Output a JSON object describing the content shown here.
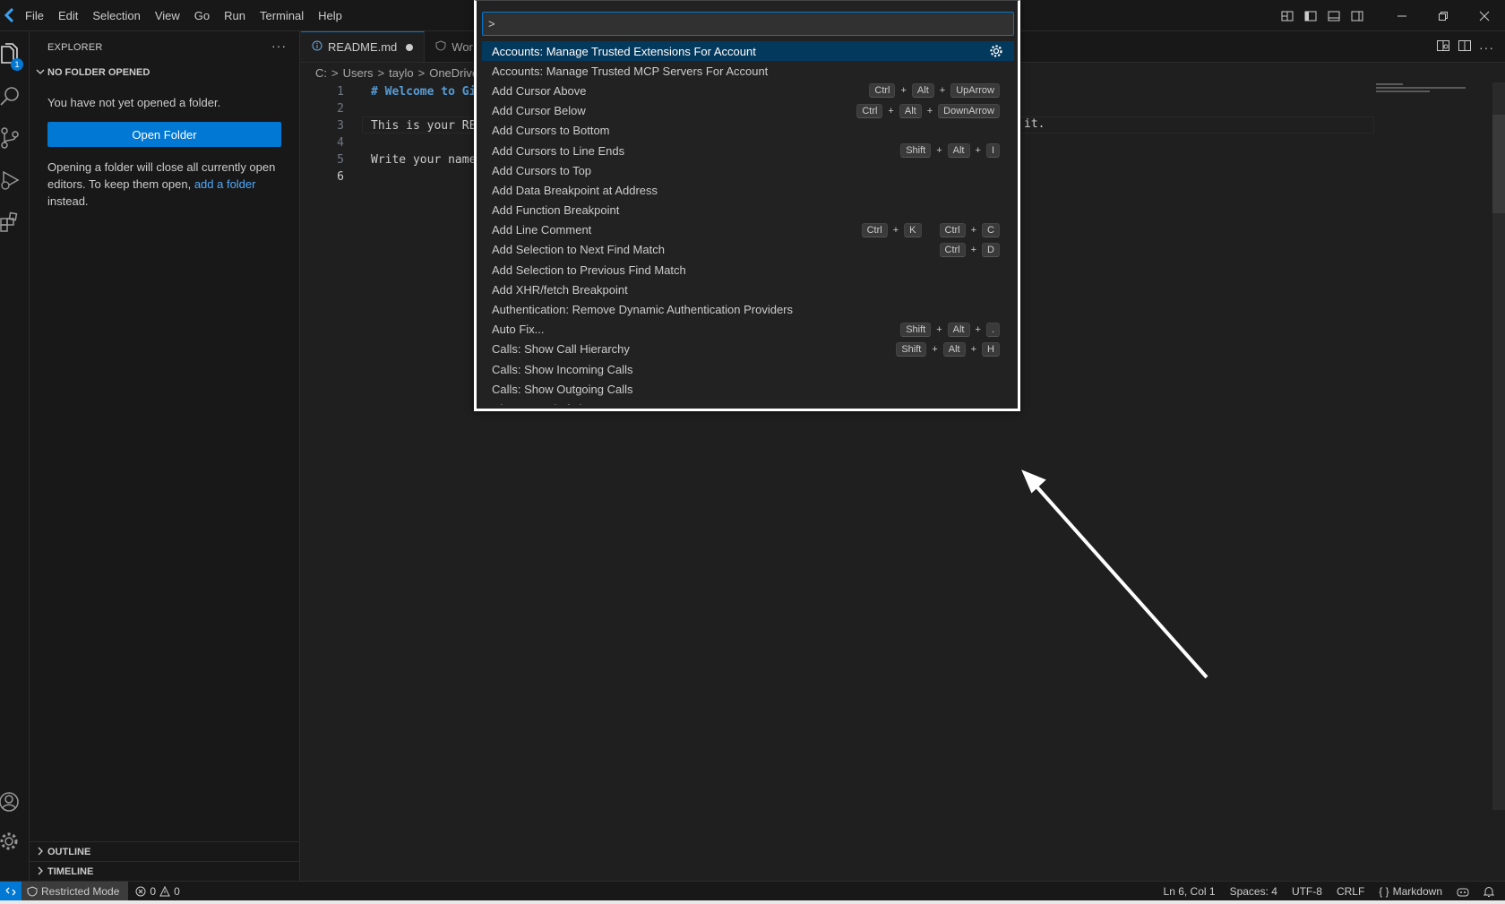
{
  "menu": [
    "File",
    "Edit",
    "Selection",
    "View",
    "Go",
    "Run",
    "Terminal",
    "Help"
  ],
  "activity": {
    "explorer_badge": "1"
  },
  "sidebar": {
    "title": "EXPLORER",
    "more": "···",
    "section": "NO FOLDER OPENED",
    "message": "You have not yet opened a folder.",
    "open_folder_label": "Open Folder",
    "note_before": "Opening a folder will close all currently open editors. To keep them open, ",
    "note_link": "add a folder",
    "note_after": " instead.",
    "outline_label": "OUTLINE",
    "timeline_label": "TIMELINE"
  },
  "tabs": [
    {
      "label": "README.md",
      "active": true,
      "dirty": true
    },
    {
      "label": "Wor",
      "active": false
    }
  ],
  "breadcrumb": [
    "C:",
    "Users",
    "taylo",
    "OneDrive"
  ],
  "code": {
    "lines": [
      {
        "n": "1",
        "text": "# Welcome to Git"
      },
      {
        "n": "2",
        "text": ""
      },
      {
        "n": "3",
        "text": "This is your REA"
      },
      {
        "n": "4",
        "text": ""
      },
      {
        "n": "5",
        "text": "Write your name "
      },
      {
        "n": "6",
        "text": ""
      }
    ],
    "overflow_text": "it."
  },
  "palette": {
    "input_value": ">",
    "items": [
      {
        "label": "Accounts: Manage Trusted Extensions For Account",
        "selected": true,
        "gear": true,
        "keys": []
      },
      {
        "label": "Accounts: Manage Trusted MCP Servers For Account",
        "keys": []
      },
      {
        "label": "Add Cursor Above",
        "keys": [
          [
            "Ctrl",
            "Alt",
            "UpArrow"
          ]
        ]
      },
      {
        "label": "Add Cursor Below",
        "keys": [
          [
            "Ctrl",
            "Alt",
            "DownArrow"
          ]
        ]
      },
      {
        "label": "Add Cursors to Bottom",
        "keys": []
      },
      {
        "label": "Add Cursors to Line Ends",
        "keys": [
          [
            "Shift",
            "Alt",
            "I"
          ]
        ]
      },
      {
        "label": "Add Cursors to Top",
        "keys": []
      },
      {
        "label": "Add Data Breakpoint at Address",
        "keys": []
      },
      {
        "label": "Add Function Breakpoint",
        "keys": []
      },
      {
        "label": "Add Line Comment",
        "keys": [
          [
            "Ctrl",
            "K"
          ],
          [
            "Ctrl",
            "C"
          ]
        ]
      },
      {
        "label": "Add Selection to Next Find Match",
        "keys": [
          [
            "Ctrl",
            "D"
          ]
        ]
      },
      {
        "label": "Add Selection to Previous Find Match",
        "keys": []
      },
      {
        "label": "Add XHR/fetch Breakpoint",
        "keys": []
      },
      {
        "label": "Authentication: Remove Dynamic Authentication Providers",
        "keys": []
      },
      {
        "label": "Auto Fix...",
        "keys": [
          [
            "Shift",
            "Alt",
            "."
          ]
        ]
      },
      {
        "label": "Calls: Show Call Hierarchy",
        "keys": [
          [
            "Shift",
            "Alt",
            "H"
          ]
        ]
      },
      {
        "label": "Calls: Show Incoming Calls",
        "keys": []
      },
      {
        "label": "Calls: Show Outgoing Calls",
        "keys": []
      },
      {
        "label": "Change End of Line Sequence",
        "keys": []
      }
    ]
  },
  "status": {
    "restricted": "Restricted Mode",
    "errors": "0",
    "warnings": "0",
    "position": "Ln 6, Col 1",
    "spaces": "Spaces: 4",
    "encoding": "UTF-8",
    "eol": "CRLF",
    "language": "Markdown"
  },
  "colors": {
    "accent": "#0078d4",
    "selected": "#04395e",
    "background": "#1f1f1f"
  }
}
